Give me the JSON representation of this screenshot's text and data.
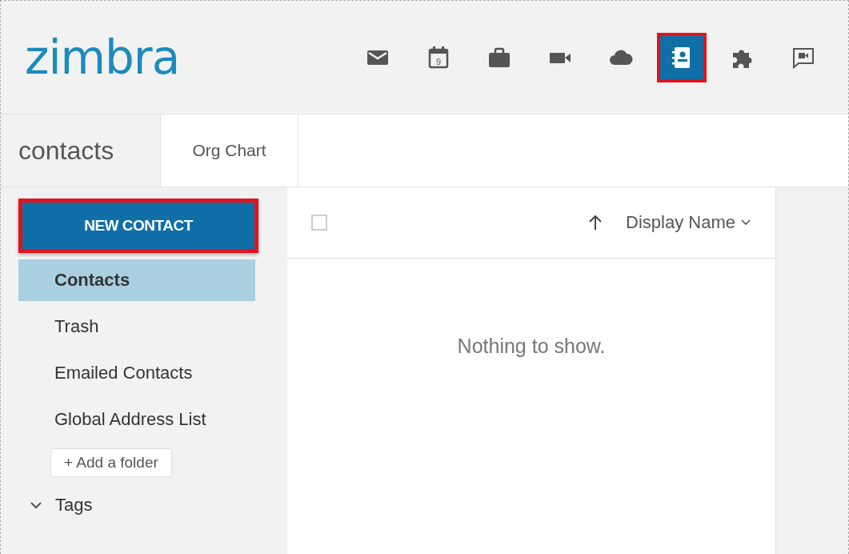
{
  "logo": "zimbra",
  "apps": [
    {
      "kind": "mail",
      "selected": false,
      "highlighted": false
    },
    {
      "kind": "calendar",
      "badge": "9",
      "selected": false,
      "highlighted": false
    },
    {
      "kind": "briefcase",
      "selected": false,
      "highlighted": false
    },
    {
      "kind": "video",
      "selected": false,
      "highlighted": false
    },
    {
      "kind": "cloud",
      "selected": false,
      "highlighted": false
    },
    {
      "kind": "contacts",
      "selected": true,
      "highlighted": true
    },
    {
      "kind": "puzzle",
      "selected": false,
      "highlighted": false
    },
    {
      "kind": "chat",
      "selected": false,
      "highlighted": false
    }
  ],
  "tabs": [
    {
      "label": "contacts",
      "kind": "title"
    },
    {
      "label": "Org Chart",
      "kind": "tab"
    }
  ],
  "new_button": {
    "label": "NEW CONTACT",
    "highlighted": true
  },
  "folders": [
    {
      "label": "Contacts",
      "selected": true
    },
    {
      "label": "Trash",
      "selected": false
    },
    {
      "label": "Emailed Contacts",
      "selected": false
    },
    {
      "label": "Global Address List",
      "selected": false
    }
  ],
  "add_folder": "+ Add a folder",
  "tags": {
    "label": "Tags"
  },
  "list": {
    "select_all_checked": false,
    "sort_label": "Display Name",
    "empty_text": "Nothing to show."
  }
}
